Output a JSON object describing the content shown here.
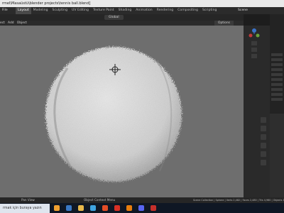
{
  "window": {
    "title": "rmel\\Masaüstü\\blender projects\\tennis ball.blend]"
  },
  "topbar": {
    "file": "File",
    "tabs": [
      "Layout",
      "Modeling",
      "Sculpting",
      "UV Editing",
      "Texture Paint",
      "Shading",
      "Animation",
      "Rendering",
      "Compositing",
      "Scripting"
    ],
    "active_tab": "Layout",
    "scene": "Scene"
  },
  "viewport_header": {
    "orientation": "Global",
    "options": "Options",
    "menus": [
      "ect",
      "Add",
      "Object"
    ]
  },
  "status": {
    "left": "Pan View",
    "mid": "Object Context Menu",
    "right": "Scene Collection | Sphere | Verts 2,482 | Faces 2,480 | Tris 4,960 | Objects 1/1"
  },
  "taskbar": {
    "search_placeholder": "rmak için buraya yazın"
  },
  "colors": {
    "viewport": "#6e6e6e",
    "accent": "#3b73c9",
    "ball": "#d8d8d8"
  }
}
